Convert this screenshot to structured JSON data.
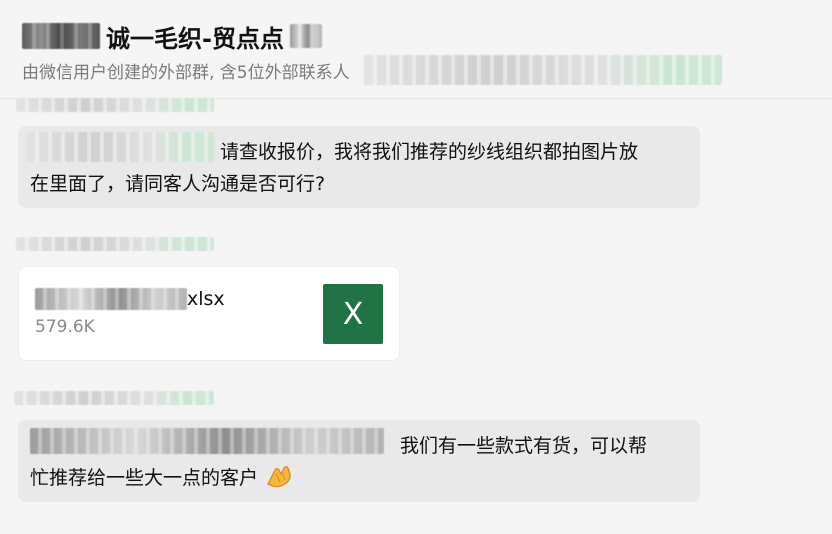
{
  "header": {
    "group_name": "诚一毛织-贸点点",
    "subtitle": "由微信用户创建的外部群, 含5位外部联系人"
  },
  "messages": [
    {
      "text_line1": "请查收报价，我将我们推荐的纱线组织都拍图片放",
      "text_line2": "在里面了，请同客人沟通是否可行?"
    },
    {
      "file_ext": "xlsx",
      "file_size": "579.6K",
      "file_icon_letter": "X"
    },
    {
      "text_line1": "我们有一些款式有货，可以帮",
      "text_line2": "忙推荐给一些大一点的客户"
    }
  ],
  "colors": {
    "background": "#f5f5f5",
    "bubble": "#e9e9e9",
    "excel_green": "#217346",
    "subtitle_gray": "#7a7a7a"
  },
  "icons": {
    "file_type": "excel-icon",
    "emoji": "clap-hands-emoji"
  }
}
